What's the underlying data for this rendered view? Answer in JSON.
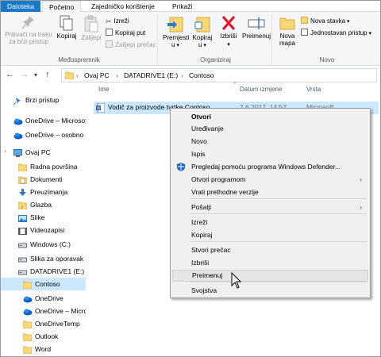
{
  "tabs": [
    "Datoteka",
    "Početno",
    "Zajedničko korištenje",
    "Prikaži"
  ],
  "ribbon": {
    "clipboard": {
      "pin": "Prikvači na traku za brzi pristup",
      "copy": "Kopiraj",
      "paste": "Zalijepi",
      "cut": "Izreži",
      "copy_path": "Kopiraj put",
      "paste_shortcut": "Zalijepi prečac",
      "label": "Međuspremnik"
    },
    "organize": {
      "move": "Premjesti u",
      "copy_to": "Kopiraj u",
      "delete": "Izbriši",
      "rename": "Preimenuj",
      "label": "Organiziraj"
    },
    "new": {
      "new_folder": "Nova mapa",
      "new_item": "Nova stavka",
      "easy_access": "Jednostavan pristup",
      "label": "Novo"
    }
  },
  "address": {
    "crumbs": [
      "Ovaj PC",
      "DATADRIVE1 (E:)",
      "Contoso"
    ]
  },
  "columns": {
    "name": "Ime",
    "date": "Datum izmjene",
    "type": "Vrsta"
  },
  "file": {
    "name": "Vodič za proizvode tvrtke Contoso",
    "date": "7.6.2017. 14:57",
    "type": "Microsoft"
  },
  "nav": [
    {
      "label": "Brzi pristup",
      "icon": "star-icon"
    },
    {
      "label": "OneDrive – Microsoft",
      "icon": "onedrive-icon"
    },
    {
      "label": "OneDrive – osobno",
      "icon": "onedrive-icon"
    },
    {
      "label": "Ovaj PC",
      "icon": "computer-icon"
    },
    {
      "label": "Radna površina",
      "icon": "folder-icon"
    },
    {
      "label": "Dokumenti",
      "icon": "documents-icon"
    },
    {
      "label": "Preuzimanja",
      "icon": "download-icon"
    },
    {
      "label": "Glazba",
      "icon": "music-icon"
    },
    {
      "label": "Slike",
      "icon": "pictures-icon"
    },
    {
      "label": "Videozapisi",
      "icon": "video-icon"
    },
    {
      "label": "Windows (C:)",
      "icon": "drive-icon"
    },
    {
      "label": "Slika za oporavak sustava",
      "icon": "drive-icon"
    },
    {
      "label": "DATADRIVE1 (E:)",
      "icon": "drive-icon"
    },
    {
      "label": "Contoso",
      "icon": "folder-icon"
    },
    {
      "label": "OneDrive",
      "icon": "onedrive-icon"
    },
    {
      "label": "OneDrive – Microsoft",
      "icon": "onedrive-icon"
    },
    {
      "label": "OneDriveTemp",
      "icon": "folder-icon"
    },
    {
      "label": "Outlook",
      "icon": "folder-icon"
    },
    {
      "label": "Word",
      "icon": "folder-icon"
    }
  ],
  "context_menu": [
    {
      "label": "Otvori"
    },
    {
      "label": "Uređivanje"
    },
    {
      "label": "Novo"
    },
    {
      "label": "Ispis"
    },
    {
      "label": "Pregledaj pomoću programa Windows Defender..."
    },
    {
      "label": "Otvori programom"
    },
    {
      "label": "Vrati prethodne verzije"
    },
    {
      "label": "Pošalji"
    },
    {
      "label": "Izreži"
    },
    {
      "label": "Kopiraj"
    },
    {
      "label": "Stvori prečac"
    },
    {
      "label": "Izbriši"
    },
    {
      "label": "Preimenuj"
    },
    {
      "label": "Svojstva"
    }
  ],
  "colors": {
    "accent": "#1979ca",
    "selection": "#cce8ff",
    "folder": "#f8d775",
    "delete_red": "#e81123"
  }
}
